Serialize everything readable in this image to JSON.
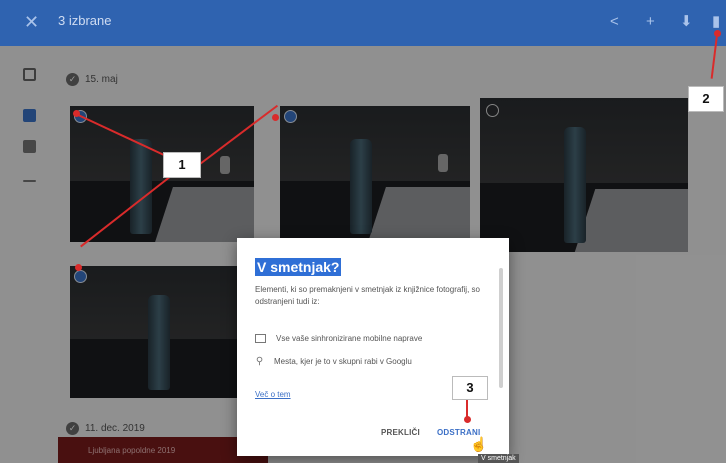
{
  "header": {
    "close_icon": "close-icon",
    "title": "3 izbrane",
    "icons": [
      "share-icon",
      "plus-icon",
      "download-icon",
      "trash-icon"
    ]
  },
  "sidebar": {
    "icons": [
      "photos-icon",
      "albums-icon",
      "assistant-icon",
      "more-icon"
    ]
  },
  "groups": [
    {
      "date": "15. maj"
    },
    {
      "date": "11. dec. 2019"
    }
  ],
  "dialog": {
    "title": "V smetnjak?",
    "body": "Elementi, ki so premaknjeni v smetnjak iz knjižnice fotografij, so odstranjeni tudi iz:",
    "items": [
      {
        "icon": "device-icon",
        "text": "Vse vaše sinhronizirane mobilne naprave"
      },
      {
        "icon": "person-icon",
        "text": "Mesta, kjer je to v skupni rabi v Googlu"
      }
    ],
    "learn_more": "Več o tem",
    "cancel": "PREKLIČI",
    "confirm": "ODSTRANI"
  },
  "tooltip": "V smetnjak",
  "callouts": [
    "1",
    "2",
    "3"
  ],
  "bottom_card": "Ljubljana popoldne 2019",
  "colors": {
    "header_bg": "#2f63b0",
    "accent": "#3b73c9",
    "annotation": "#d92b2b"
  }
}
